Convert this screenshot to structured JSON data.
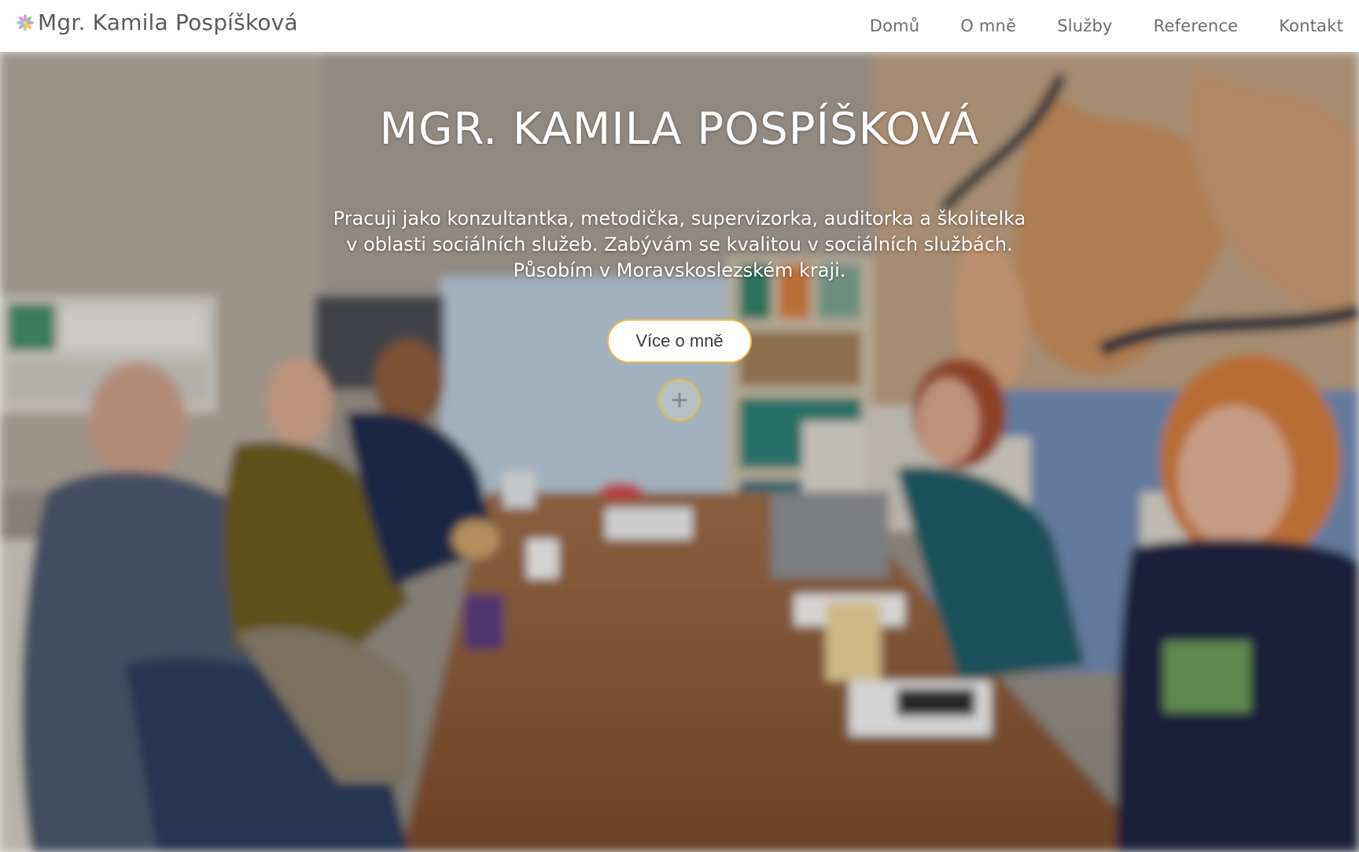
{
  "navbar": {
    "brand": "Mgr. Kamila Pospíšková",
    "links": [
      "Domů",
      "O mně",
      "Služby",
      "Reference",
      "Kontakt"
    ]
  },
  "hero": {
    "title": "MGR. KAMILA POSPÍŠKOVÁ",
    "description_lines": [
      "Pracuji jako konzultantka, metodička, supervizorka, auditorka a školitelka",
      "v oblasti sociálních služeb. Zabývám se kvalitou v sociálních službách.",
      "Působím v Moravskoslezském kraji."
    ],
    "button_label": "Více o mně",
    "expand_icon": "plus-icon"
  },
  "colors": {
    "accent": "#e7b949",
    "nav_text": "#6e6e6e",
    "brand_text": "#5b5b5b"
  }
}
